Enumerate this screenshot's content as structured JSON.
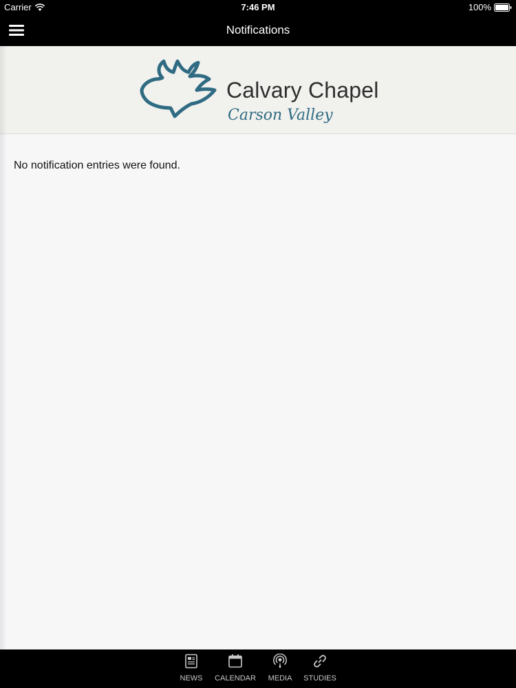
{
  "status_bar": {
    "carrier": "Carrier",
    "time": "7:46 PM",
    "battery": "100%"
  },
  "nav": {
    "title": "Notifications",
    "menu_icon": "hamburger-menu-icon"
  },
  "banner": {
    "title": "Calvary Chapel",
    "subtitle": "Carson Valley",
    "colors": {
      "logo": "#2f6b82"
    }
  },
  "content": {
    "empty_message": "No notification entries were found."
  },
  "tabs": [
    {
      "label": "NEWS",
      "icon": "news-icon"
    },
    {
      "label": "CALENDAR",
      "icon": "calendar-icon"
    },
    {
      "label": "MEDIA",
      "icon": "podcast-icon"
    },
    {
      "label": "STUDIES",
      "icon": "link-icon"
    }
  ]
}
